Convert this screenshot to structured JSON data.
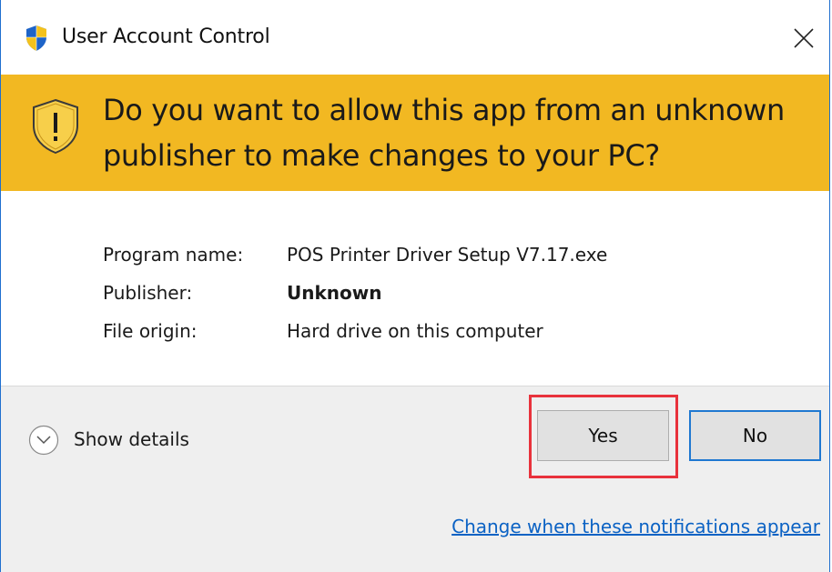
{
  "window": {
    "title": "User Account Control",
    "close_glyph": "✕"
  },
  "banner": {
    "question": "Do you want to allow this app from an unknown publisher to make changes to your PC?",
    "icon": "warning-shield-icon",
    "background_color": "#f2b822"
  },
  "info": {
    "rows": [
      {
        "label": "Program name:",
        "value": "POS Printer Driver Setup V7.17.exe"
      },
      {
        "label": "Publisher:",
        "value": "Unknown"
      },
      {
        "label": "File origin:",
        "value": "Hard drive on this computer"
      }
    ]
  },
  "footer": {
    "show_details_label": "Show details",
    "yes_label": "Yes",
    "no_label": "No",
    "notification_link": "Change when these notifications appear",
    "highlight_color": "#e8323c",
    "link_color": "#0b62c4"
  }
}
